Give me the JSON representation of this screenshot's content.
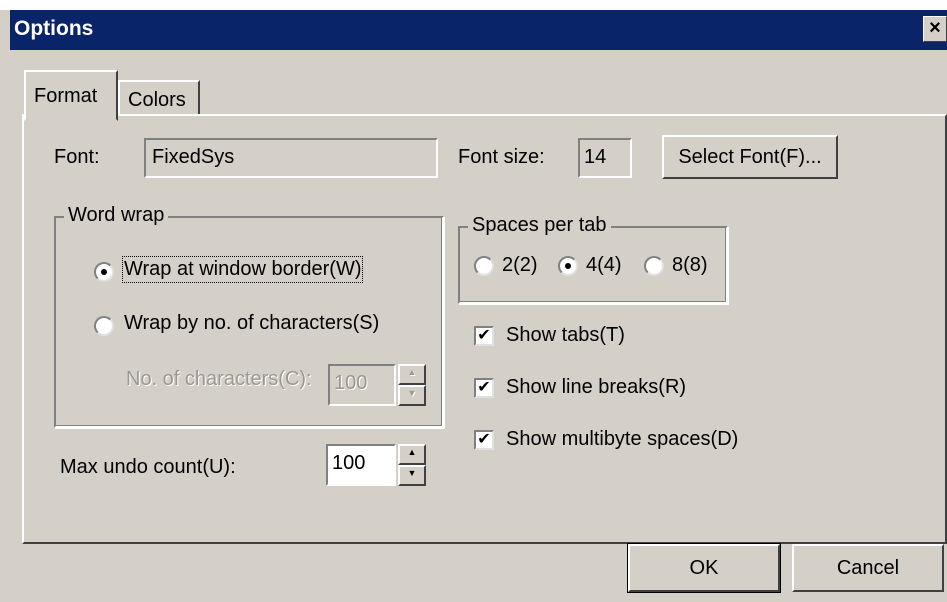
{
  "window": {
    "title": "Options",
    "close_label": "×"
  },
  "tabs": [
    {
      "label": "Format"
    },
    {
      "label": "Colors"
    }
  ],
  "format": {
    "font_label": "Font:",
    "font_value": "FixedSys",
    "font_size_label": "Font size:",
    "font_size_value": "14",
    "select_font_button": "Select Font(F)...",
    "word_wrap": {
      "group_label": "Word wrap",
      "option_border": "Wrap at window border(W)",
      "option_chars": "Wrap by no. of characters(S)",
      "selected": "border",
      "chars_label": "No. of characters(C):",
      "chars_value": "100"
    },
    "spaces_per_tab": {
      "group_label": "Spaces per tab",
      "options": [
        "2(2)",
        "4(4)",
        "8(8)"
      ],
      "selected": "4(4)"
    },
    "checkboxes": [
      {
        "label": "Show tabs(T)",
        "checked": true
      },
      {
        "label": "Show line breaks(R)",
        "checked": true
      },
      {
        "label": "Show multibyte spaces(D)",
        "checked": true
      }
    ],
    "max_undo_label": "Max undo count(U):",
    "max_undo_value": "100"
  },
  "buttons": {
    "ok": "OK",
    "cancel": "Cancel"
  }
}
